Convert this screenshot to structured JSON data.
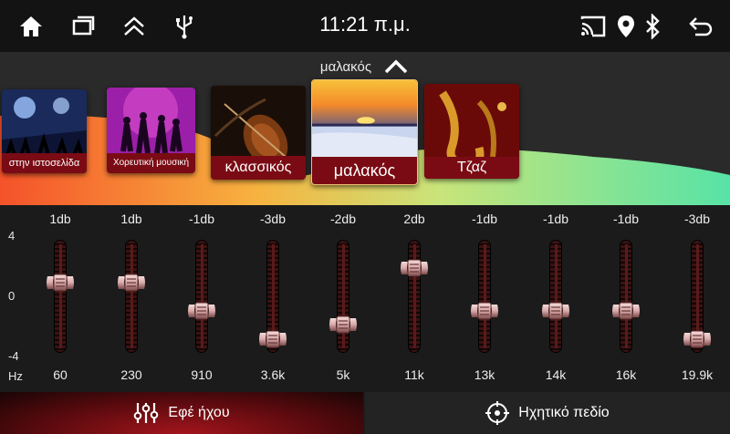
{
  "status_bar": {
    "time": "11:21 π.μ.",
    "icons_left": [
      "home-icon",
      "recent-apps-icon",
      "collapse-up-icon",
      "usb-icon"
    ],
    "icons_right": [
      "cast-icon",
      "location-icon",
      "bluetooth-icon",
      "back-icon"
    ]
  },
  "presets": {
    "current": "μαλακός",
    "items": [
      {
        "label": "στην ιστοσελίδα"
      },
      {
        "label": "Χορευτική μουσική"
      },
      {
        "label": "κλασσικός"
      },
      {
        "label": "μαλακός"
      },
      {
        "label": "Τζαζ"
      }
    ]
  },
  "equalizer": {
    "scale": {
      "max": "4",
      "mid": "0",
      "min": "-4",
      "unit": "Hz"
    },
    "bands": [
      {
        "db": "1db",
        "hz": "60",
        "level": 1
      },
      {
        "db": "1db",
        "hz": "230",
        "level": 1
      },
      {
        "db": "-1db",
        "hz": "910",
        "level": -1
      },
      {
        "db": "-3db",
        "hz": "3.6k",
        "level": -3
      },
      {
        "db": "-2db",
        "hz": "5k",
        "level": -2
      },
      {
        "db": "2db",
        "hz": "11k",
        "level": 2
      },
      {
        "db": "-1db",
        "hz": "13k",
        "level": -1
      },
      {
        "db": "-1db",
        "hz": "14k",
        "level": -1
      },
      {
        "db": "-1db",
        "hz": "16k",
        "level": -1
      },
      {
        "db": "-3db",
        "hz": "19.9k",
        "level": -3
      }
    ]
  },
  "tabs": {
    "effects": "Εφέ ήχου",
    "field": "Ηχητικό πεδίο"
  },
  "colors": {
    "accent_red": "#a3151c",
    "label_red": "#7a0b14",
    "curve_green": "#57e3a6",
    "curve_orange": "#f07d36"
  }
}
